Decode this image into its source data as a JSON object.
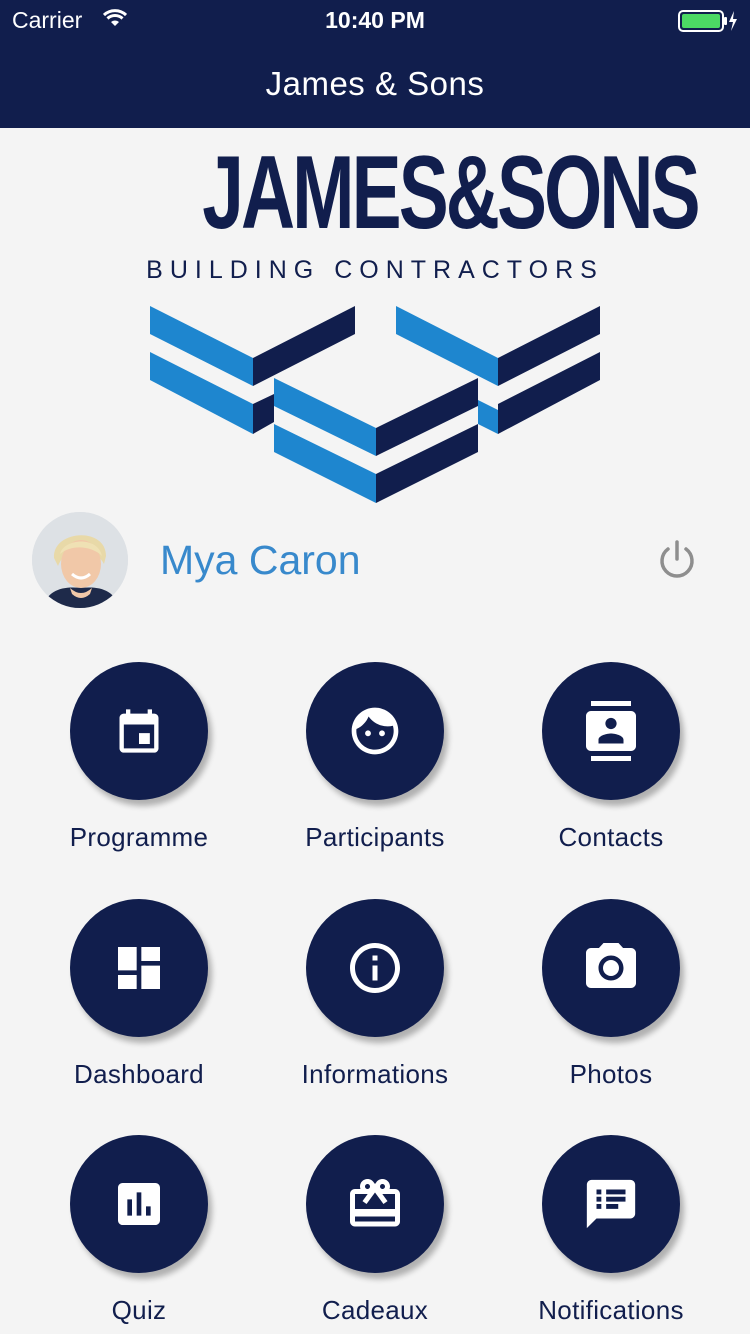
{
  "status_bar": {
    "carrier": "Carrier",
    "time": "10:40 PM"
  },
  "nav": {
    "title": "James & Sons"
  },
  "logo": {
    "main_text": "JAMES&SONS",
    "sub_text": "BUILDING CONTRACTORS"
  },
  "profile": {
    "name": "Mya Caron"
  },
  "menu": [
    {
      "label": "Programme",
      "icon": "calendar-icon"
    },
    {
      "label": "Participants",
      "icon": "face-icon"
    },
    {
      "label": "Contacts",
      "icon": "contacts-icon"
    },
    {
      "label": "Dashboard",
      "icon": "dashboard-icon"
    },
    {
      "label": "Informations",
      "icon": "info-icon"
    },
    {
      "label": "Photos",
      "icon": "camera-icon"
    },
    {
      "label": "Quiz",
      "icon": "chart-icon"
    },
    {
      "label": "Cadeaux",
      "icon": "gift-card-icon"
    },
    {
      "label": "Notifications",
      "icon": "message-icon"
    }
  ],
  "colors": {
    "brand_navy": "#111e4d",
    "brand_blue": "#1e86cf",
    "name_blue": "#3889cc"
  }
}
